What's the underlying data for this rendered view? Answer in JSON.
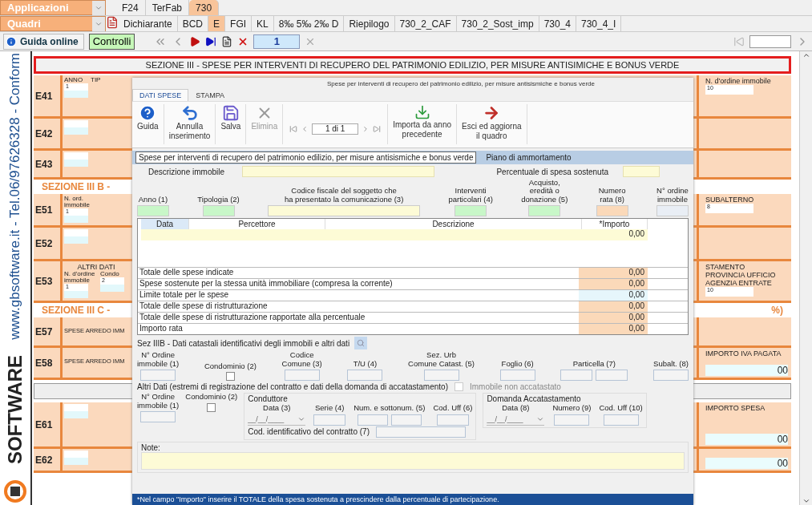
{
  "apps_menu": {
    "label": "Applicazioni"
  },
  "quadri_menu": {
    "label": "Quadri"
  },
  "app_tabs": [
    {
      "label": "F24",
      "selected": false
    },
    {
      "label": "TerFab",
      "selected": false
    },
    {
      "label": "730",
      "selected": true
    }
  ],
  "quadri_tabs": [
    {
      "label": "Dichiarante",
      "selected": false
    },
    {
      "label": "BCD",
      "selected": false
    },
    {
      "label": "E",
      "selected": true
    },
    {
      "label": "FGI",
      "selected": false
    },
    {
      "label": "KL",
      "selected": false
    },
    {
      "label": "8‰  5‰  2‰  D",
      "selected": false
    },
    {
      "label": "Riepilogo",
      "selected": false
    },
    {
      "label": "730_2_CAF",
      "selected": false
    },
    {
      "label": "730_2_Sost_imp",
      "selected": false
    },
    {
      "label": "730_4",
      "selected": false
    },
    {
      "label": "730_4_I",
      "selected": false
    }
  ],
  "toolbar": {
    "guide": "Guida online",
    "check": "Controlli",
    "page": "1"
  },
  "brand": {
    "contact": "www.gbsoftware.it - Tel.06/97626328 - Conform",
    "logo": "SOFTWARE"
  },
  "section_title": "SEZIONE III - SPESE PER INTERVENTI DI RECUPERO DEL PATRIMONIO EDILIZIO, PER MISURE ANTISIMICHE E BONUS VERDE",
  "form_rows": [
    {
      "kind": "row",
      "code": "E41",
      "fields": [
        {
          "label": "ANNO",
          "value": "1"
        },
        {
          "label": "TIP"
        }
      ],
      "right_label": "N. d'ordine immobile",
      "right_value": "10"
    },
    {
      "kind": "row",
      "code": "E42"
    },
    {
      "kind": "row",
      "code": "E43"
    },
    {
      "kind": "section",
      "title": "SEZIONE III B -"
    },
    {
      "kind": "row",
      "code": "E51",
      "fields": [
        {
          "label": "N. ord. immobile",
          "value": "1"
        }
      ],
      "right_label": "SUBALTERNO",
      "right_value": "8"
    },
    {
      "kind": "row",
      "code": "E52"
    },
    {
      "kind": "row",
      "code": "E53",
      "header": "ALTRI DATI",
      "fields": [
        {
          "label": "N. d'ordine immobile",
          "value": "1"
        },
        {
          "label": "Condo",
          "value": "2"
        }
      ],
      "right_header": "STAMENTO",
      "right_label": "PROVINCIA UFFICIO AGENZIA ENTRATE",
      "right_value": "10"
    },
    {
      "kind": "section",
      "title": "SEZIONE III C -",
      "right": "%)"
    },
    {
      "kind": "row",
      "code": "E57",
      "text": "SPESE ARREDO IMM"
    },
    {
      "kind": "row",
      "code": "E58",
      "text": "SPESE ARREDO IMM",
      "right_label": "IMPORTO IVA PAGATA",
      "right_value": "00"
    },
    {
      "kind": "bar"
    },
    {
      "kind": "row",
      "code": "E61",
      "right_label": "IMPORTO SPESA",
      "right_value": "00"
    },
    {
      "kind": "row",
      "code": "E62",
      "right_value": "00"
    }
  ],
  "dialog": {
    "subtitle": "Spese per interventi di recupero del patrimonio edilizio, per misure antisismiche e bonus verde",
    "tabs": [
      {
        "label": "DATI SPESE",
        "selected": true
      },
      {
        "label": "STAMPA",
        "selected": false
      }
    ],
    "ribbon": [
      {
        "kind": "help",
        "label": "Guida",
        "disabled": false
      },
      {
        "kind": "undo",
        "label": "Annulla\ninserimento",
        "disabled": false
      },
      {
        "kind": "save",
        "label": "Salva",
        "disabled": false
      },
      {
        "kind": "delete",
        "label": "Elimina",
        "disabled": true
      },
      {
        "kind": "pager",
        "value": "1 di 1"
      },
      {
        "kind": "import",
        "label": "Importa da anno\nprecedente",
        "disabled": false
      },
      {
        "kind": "exit",
        "label": "Esci ed aggiorna\nil quadro",
        "disabled": false
      }
    ],
    "inner_tabs": [
      {
        "label": "Spese per interventi di recupero del patrimonio edilizio, per misure antisismiche e bonus verde",
        "selected": true
      },
      {
        "label": "Piano di ammortamento",
        "selected": false
      }
    ],
    "description_label": "Descrizione immobile",
    "percentage_label": "Percentuale di spesa sostenuta",
    "fields": [
      {
        "label": "Anno (1)",
        "color": "#c8f7c8"
      },
      {
        "label": "Tipologia (2)",
        "color": "#c8f7c8"
      },
      {
        "label": "Codice fiscale del soggetto che\nha presentato la comunicazione (3)",
        "color": "#fdfbd6"
      },
      {
        "label": "Interventi\nparticolari (4)",
        "color": "#c8f7c8"
      },
      {
        "label": "Acquisto,\neredità o\ndonazione (5)",
        "color": "#c8f7c8"
      },
      {
        "label": "Numero\nrata (8)",
        "color": "#fbd9b9"
      },
      {
        "label": "N° ordine\nimmobile",
        "color": "#e9eef5"
      }
    ],
    "grid": {
      "columns": [
        "Data",
        "Percettore",
        "Descrizione",
        "*Importo"
      ],
      "rows": [
        {
          "amount": "0,00"
        }
      ]
    },
    "totals": [
      {
        "label": "Totale delle spese indicate",
        "value": "0,00",
        "color": "#fbd9b9"
      },
      {
        "label": "Spese sostenute per la stessa unità immobiliare (compresa la corrente)",
        "value": "0,00",
        "color": "#fbd9b9"
      },
      {
        "label": "Limite totale per le spese",
        "value": "0,00",
        "color": "#e6f6fb"
      },
      {
        "label": "Totale delle spese di ristrutturazione",
        "value": "0,00",
        "color": "#fbd9b9"
      },
      {
        "label": "Totale delle spese di ristrutturazione rapportate alla percentuale",
        "value": "0,00",
        "color": "#fbd9b9"
      },
      {
        "label": "Importo rata",
        "value": "0,00",
        "color": "#fbd9b9"
      }
    ],
    "cadastral": {
      "title": "Sez IIIB - Dati catastali identificativi degli immobili e altri dati",
      "fields": [
        {
          "kind": "input",
          "label": "N° Ordine\nimmobile (1)"
        },
        {
          "kind": "checkbox",
          "label": "Condominio (2)",
          "checked": false
        },
        {
          "kind": "input",
          "label": "Codice\nComune (3)"
        },
        {
          "kind": "input",
          "label": "T/U (4)"
        },
        {
          "kind": "input",
          "label": "Sez. Urb\nComune Catast. (5)"
        },
        {
          "kind": "input",
          "label": "Foglio (6)"
        },
        {
          "kind": "double",
          "label": "Particella (7)"
        },
        {
          "kind": "input",
          "label": "Subalt. (8)"
        }
      ]
    },
    "other": {
      "title": "Altri Dati (estremi di registrazione del contratto e dati della domanda di accatastamento)",
      "unregistered": {
        "label": "Immobile non accatastato",
        "checked": false,
        "disabled": true
      },
      "fields": [
        {
          "kind": "input",
          "label": "N° Ordine\nimmobile (1)"
        },
        {
          "kind": "checkbox",
          "label": "Condominio (2)",
          "checked": false
        }
      ],
      "tenant": {
        "title": "Conduttore",
        "fields": [
          {
            "kind": "date",
            "label": "Data (3)",
            "value": "__/__/____"
          },
          {
            "kind": "input",
            "label": "Serie (4)"
          },
          {
            "kind": "double",
            "label": "Num. e sottonum. (5)"
          },
          {
            "kind": "input",
            "label": "Cod. Uff (6)"
          }
        ],
        "contract_label": "Cod. identificativo del contratto (7)"
      },
      "application": {
        "title": "Domanda Accatastamento",
        "fields": [
          {
            "kind": "date",
            "label": "Data (8)",
            "value": "__/__/____"
          },
          {
            "kind": "input",
            "label": "Numero (9)"
          },
          {
            "kind": "input",
            "label": "Cod. Uff (10)"
          }
        ]
      }
    },
    "note_label": "Note:",
    "footer": "*Nel campo \"Importo\" inserire il TOTALE della spesa sostenuta a prescindere dalla percentuale di partecipazione."
  }
}
